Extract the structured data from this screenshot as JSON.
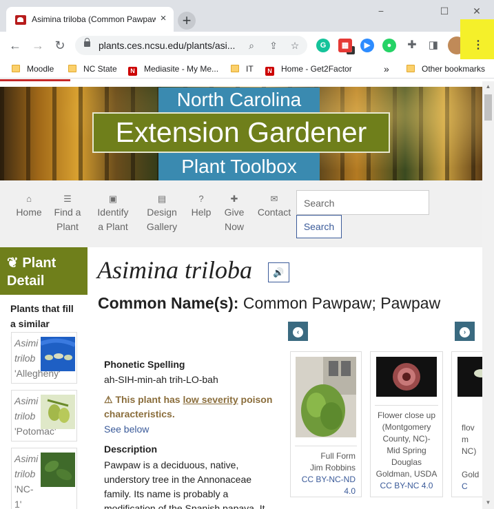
{
  "browser": {
    "tab_title": "Asimina triloba (Common Pawpaw) | North Carolina Extension Gardener Plant Toolbox",
    "tab_close": "×",
    "new_tab": "+",
    "url": "plants.ces.ncsu.edu/plants/asi...",
    "window_controls": {
      "minimize": "−",
      "maximize": "☐",
      "close": "✕"
    },
    "extensions": [
      {
        "name": "grammarly-icon",
        "label": "G",
        "color": "#15c39a"
      },
      {
        "name": "calendar-extension-icon",
        "label": "▦",
        "color": "#e53935",
        "badge": "9"
      },
      {
        "name": "zoom-icon",
        "label": "▶",
        "color": "#2d8cff"
      },
      {
        "name": "chat-extension-icon",
        "label": "●",
        "color": "#25d366"
      }
    ],
    "bookmarks": [
      {
        "label": "Moodle",
        "icon": "folder"
      },
      {
        "label": "NC State",
        "icon": "folder"
      },
      {
        "label": "Mediasite - My Me...",
        "icon": "nc"
      },
      {
        "label": "IT",
        "icon": "folder"
      },
      {
        "label": "Home - Get2Factor",
        "icon": "nc"
      }
    ],
    "bookmarks_overflow": "»",
    "other_bookmarks": "Other bookmarks",
    "menu_dots": "⋮"
  },
  "banner": {
    "line1": "North Carolina",
    "line2": "Extension Gardener",
    "line3": "Plant Toolbox"
  },
  "nav": {
    "items": [
      {
        "icon": "⌂",
        "line1": "Home",
        "line2": ""
      },
      {
        "icon": "☰",
        "line1": "Find a",
        "line2": "Plant"
      },
      {
        "icon": "▣",
        "line1": "Identify",
        "line2": "a Plant"
      },
      {
        "icon": "▤",
        "line1": "Design",
        "line2": "Gallery"
      },
      {
        "icon": "?",
        "line1": "Help",
        "line2": ""
      },
      {
        "icon": "✚",
        "line1": "Give",
        "line2": "Now"
      },
      {
        "icon": "✉",
        "line1": "Contact",
        "line2": ""
      }
    ],
    "search_placeholder": "Search",
    "search_button": "Search"
  },
  "sidebar": {
    "title_line1": "Plant",
    "title_line2": "Detail",
    "subtitle": "Plants that fill a similar niche:",
    "cards": [
      {
        "italic1": "Asimi",
        "italic2": "trilob",
        "cultivar": "'Allegheny'"
      },
      {
        "italic1": "Asimi",
        "italic2": "trilob",
        "cultivar": "'Potomac'"
      },
      {
        "italic1": "Asimi",
        "italic2": "trilob",
        "cultivar": "'NC-",
        "cultivar2": "1'"
      }
    ]
  },
  "plant": {
    "scientific_name": "Asimina triloba",
    "common_names_label": "Common Name(s):",
    "common_names": "Common Pawpaw;  Pawpaw",
    "phonetic_label": "Phonetic Spelling",
    "phonetic": "ah-SIH-min-ah trih-LO-bah",
    "poison_prefix": "This plant has ",
    "poison_link": "low severity",
    "poison_suffix": " poison characteristics.",
    "see_below": "See below",
    "description_label": "Description",
    "description": "Pawpaw is a deciduous, native, understory tree in the Annonaceae family. Its name is probably a modification of the Spanish papaya. It"
  },
  "gallery": {
    "prev": "‹",
    "next": "›",
    "cards": [
      {
        "caption_lines": [
          "Full Form",
          "Jim Robbins"
        ],
        "license_lines": [
          "CC BY-NC-ND",
          "4.0"
        ]
      },
      {
        "caption_lines": [
          "Flower close up",
          "(Montgomery",
          "County, NC)-",
          "Mid Spring",
          "Douglas",
          "Goldman, USDA"
        ],
        "license_lines": [
          "CC BY-NC 4.0"
        ]
      },
      {
        "caption_lines": [
          "flov",
          "m",
          "NC)",
          "",
          "Gold"
        ],
        "license_lines": [
          "C"
        ]
      }
    ]
  }
}
